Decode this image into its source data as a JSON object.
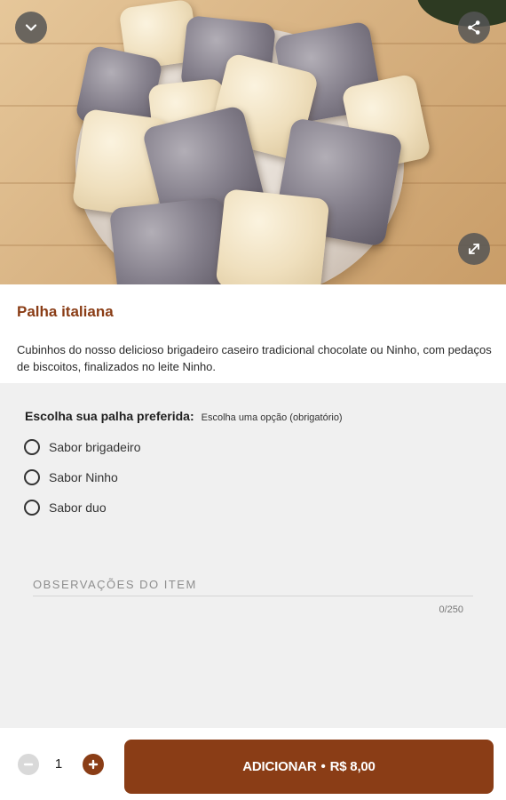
{
  "product": {
    "name": "Palha italiana",
    "description": "Cubinhos do nosso delicioso brigadeiro caseiro tradicional chocolate ou Ninho, com pedaços de biscoitos, finalizados no leite Ninho."
  },
  "hero_icons": {
    "back": "chevron-down-icon",
    "share": "share-icon",
    "expand": "expand-icon"
  },
  "options_group": {
    "title": "Escolha sua palha preferida:",
    "hint": "Escolha uma opção (obrigatório)",
    "options": [
      {
        "label": "Sabor brigadeiro",
        "selected": false
      },
      {
        "label": "Sabor Ninho",
        "selected": false
      },
      {
        "label": "Sabor duo",
        "selected": false
      }
    ]
  },
  "notes": {
    "placeholder": "OBSERVAÇÕES DO ITEM",
    "value": "",
    "counter": "0/250"
  },
  "cart": {
    "quantity": "1",
    "add_label": "ADICIONAR",
    "separator": "•",
    "price": "R$ 8,00"
  },
  "colors": {
    "accent": "#8a3d16",
    "panel_bg": "#f0f0f0",
    "icon_overlay": "#555555"
  }
}
